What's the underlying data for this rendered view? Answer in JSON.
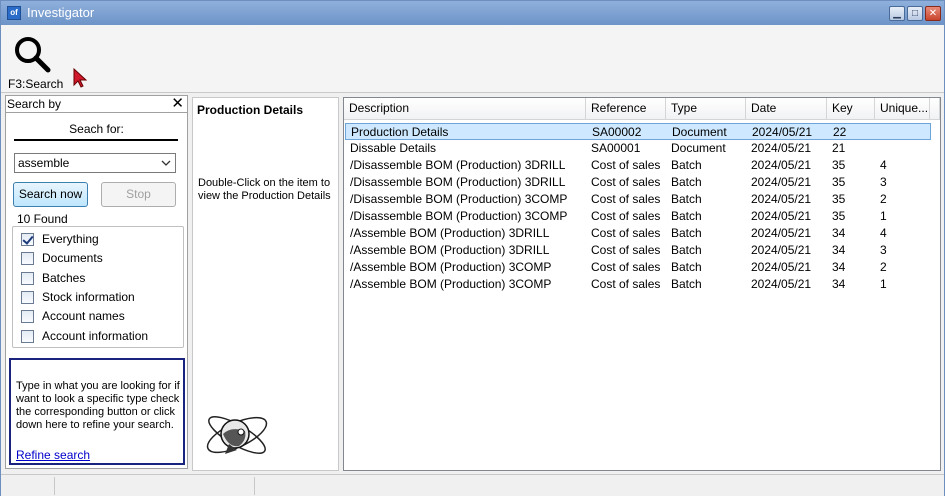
{
  "window": {
    "app_icon_text": "of",
    "title": "Investigator",
    "minimize": "▁",
    "maximize": "□",
    "close": "✕"
  },
  "toolbar": {
    "search_label": "F3:Search"
  },
  "search_panel": {
    "header": "Search by",
    "close": "✕",
    "search_for_label": "Seach for:",
    "query_value": "assemble",
    "search_button": "Search now",
    "stop_button": "Stop",
    "found_text": "10 Found",
    "filters": [
      {
        "label": "Everything",
        "checked": true
      },
      {
        "label": "Documents",
        "checked": false
      },
      {
        "label": "Batches",
        "checked": false
      },
      {
        "label": "Stock information",
        "checked": false
      },
      {
        "label": "Account names",
        "checked": false
      },
      {
        "label": "Account information",
        "checked": false
      }
    ],
    "info_text": "Type in what you are looking for if want to look a specific type check the corresponding button or click down here to refine your search.",
    "refine_link": "Refine search"
  },
  "details_panel": {
    "title": "Production Details",
    "hint": "Double-Click on the item to view the Production Details"
  },
  "results": {
    "columns": [
      "Description",
      "Reference",
      "Type",
      "Date",
      "Key",
      "Unique..."
    ],
    "selected_index": 0,
    "rows": [
      [
        "Production Details",
        "SA00002",
        "Document",
        "2024/05/21",
        "22",
        ""
      ],
      [
        "Dissable Details",
        "SA00001",
        "Document",
        "2024/05/21",
        "21",
        ""
      ],
      [
        "/Disassemble BOM (Production) 3DRILL",
        "Cost of sales",
        "Batch",
        "2024/05/21",
        "35",
        "4"
      ],
      [
        "/Disassemble BOM (Production) 3DRILL",
        "Cost of sales",
        "Batch",
        "2024/05/21",
        "35",
        "3"
      ],
      [
        "/Disassemble BOM (Production) 3COMP",
        "Cost of sales",
        "Batch",
        "2024/05/21",
        "35",
        "2"
      ],
      [
        "/Disassemble BOM (Production) 3COMP",
        "Cost of sales",
        "Batch",
        "2024/05/21",
        "35",
        "1"
      ],
      [
        "/Assemble BOM (Production) 3DRILL",
        "Cost of sales",
        "Batch",
        "2024/05/21",
        "34",
        "4"
      ],
      [
        "/Assemble BOM (Production) 3DRILL",
        "Cost of sales",
        "Batch",
        "2024/05/21",
        "34",
        "3"
      ],
      [
        "/Assemble BOM (Production) 3COMP",
        "Cost of sales",
        "Batch",
        "2024/05/21",
        "34",
        "2"
      ],
      [
        "/Assemble BOM (Production) 3COMP",
        "Cost of sales",
        "Batch",
        "2024/05/21",
        "34",
        "1"
      ]
    ]
  },
  "icons": {
    "toolbar_search": "magnifier-icon",
    "cursor": "mouse-pointer-icon",
    "combo": "chevron-down-icon",
    "logo": "investigator-logo-icon"
  },
  "colors": {
    "selection": "#cde8ff",
    "link": "#0000cc",
    "info_border": "#1a237e",
    "title_bar": "#7a9fd2"
  }
}
